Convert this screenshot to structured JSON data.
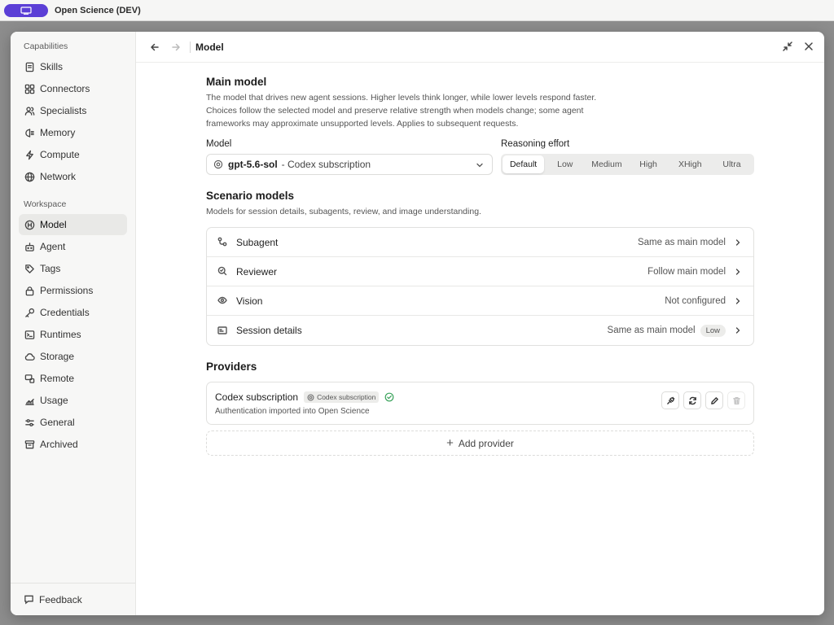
{
  "app": {
    "title": "Open Science (DEV)",
    "accent": "#5b3fd6"
  },
  "sidebar": {
    "capabilities_label": "Capabilities",
    "capabilities": [
      {
        "label": "Skills",
        "icon": "skills-icon"
      },
      {
        "label": "Connectors",
        "icon": "connectors-icon"
      },
      {
        "label": "Specialists",
        "icon": "specialists-icon"
      },
      {
        "label": "Memory",
        "icon": "memory-icon"
      },
      {
        "label": "Compute",
        "icon": "compute-icon"
      },
      {
        "label": "Network",
        "icon": "network-icon"
      }
    ],
    "workspace_label": "Workspace",
    "workspace": [
      {
        "label": "Model",
        "icon": "model-icon",
        "active": true
      },
      {
        "label": "Agent",
        "icon": "agent-icon"
      },
      {
        "label": "Tags",
        "icon": "tags-icon"
      },
      {
        "label": "Permissions",
        "icon": "permissions-icon"
      },
      {
        "label": "Credentials",
        "icon": "credentials-icon"
      },
      {
        "label": "Runtimes",
        "icon": "runtimes-icon"
      },
      {
        "label": "Storage",
        "icon": "storage-icon"
      },
      {
        "label": "Remote",
        "icon": "remote-icon"
      },
      {
        "label": "Usage",
        "icon": "usage-icon"
      },
      {
        "label": "General",
        "icon": "general-icon"
      },
      {
        "label": "Archived",
        "icon": "archived-icon"
      }
    ],
    "feedback": "Feedback"
  },
  "header": {
    "title": "Model"
  },
  "main_model": {
    "heading": "Main model",
    "description": "The model that drives new agent sessions. Higher levels think longer, while lower levels respond faster. Choices follow the selected model and preserve relative strength when models change; some agent frameworks may approximate unsupported levels. Applies to subsequent requests.",
    "model_label": "Model",
    "model_name": "gpt-5.6-sol",
    "model_provider": "- Codex subscription",
    "effort_label": "Reasoning effort",
    "effort_options": [
      "Default",
      "Low",
      "Medium",
      "High",
      "XHigh",
      "Ultra"
    ],
    "effort_selected": "Default"
  },
  "scenario": {
    "heading": "Scenario models",
    "description": "Models for session details, subagents, review, and image understanding.",
    "rows": [
      {
        "label": "Subagent",
        "value": "Same as main model",
        "icon": "subagent-icon"
      },
      {
        "label": "Reviewer",
        "value": "Follow main model",
        "icon": "reviewer-icon"
      },
      {
        "label": "Vision",
        "value": "Not configured",
        "icon": "vision-icon"
      },
      {
        "label": "Session details",
        "value": "Same as main model",
        "badge": "Low",
        "icon": "session-details-icon"
      }
    ]
  },
  "providers": {
    "heading": "Providers",
    "items": [
      {
        "name": "Codex subscription",
        "tag": "Codex subscription",
        "status": "connected",
        "subtitle": "Authentication imported into Open Science"
      }
    ],
    "add_label": "Add provider"
  }
}
